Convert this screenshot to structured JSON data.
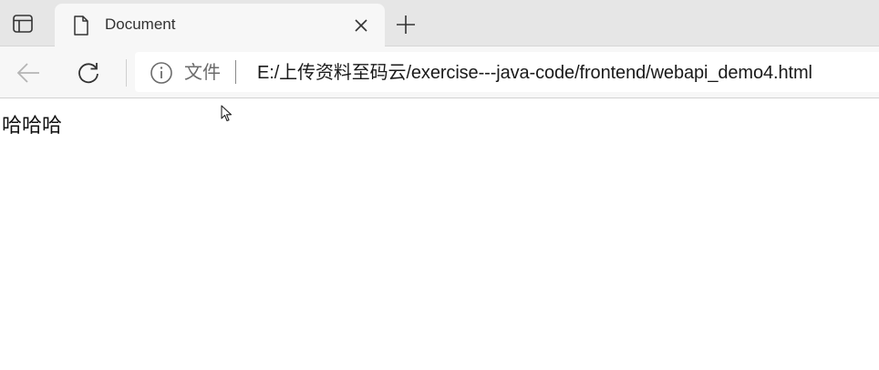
{
  "browser": {
    "tab": {
      "title": "Document",
      "favicon": "document-icon"
    },
    "toolbar": {
      "site_info_label": "文件",
      "address": "E:/上传资料至码云/exercise---java-code/frontend/webapi_demo4.html"
    },
    "icons": {
      "tab_actions": "tab-actions-icon",
      "close": "close-icon",
      "new_tab": "plus-icon",
      "back": "back-arrow-icon",
      "refresh": "refresh-icon",
      "info": "info-icon"
    }
  },
  "page": {
    "text": "哈哈哈"
  },
  "colors": {
    "tabstrip_bg": "#e6e6e6",
    "active_tab_bg": "#f7f7f7",
    "page_bg": "#ffffff"
  }
}
